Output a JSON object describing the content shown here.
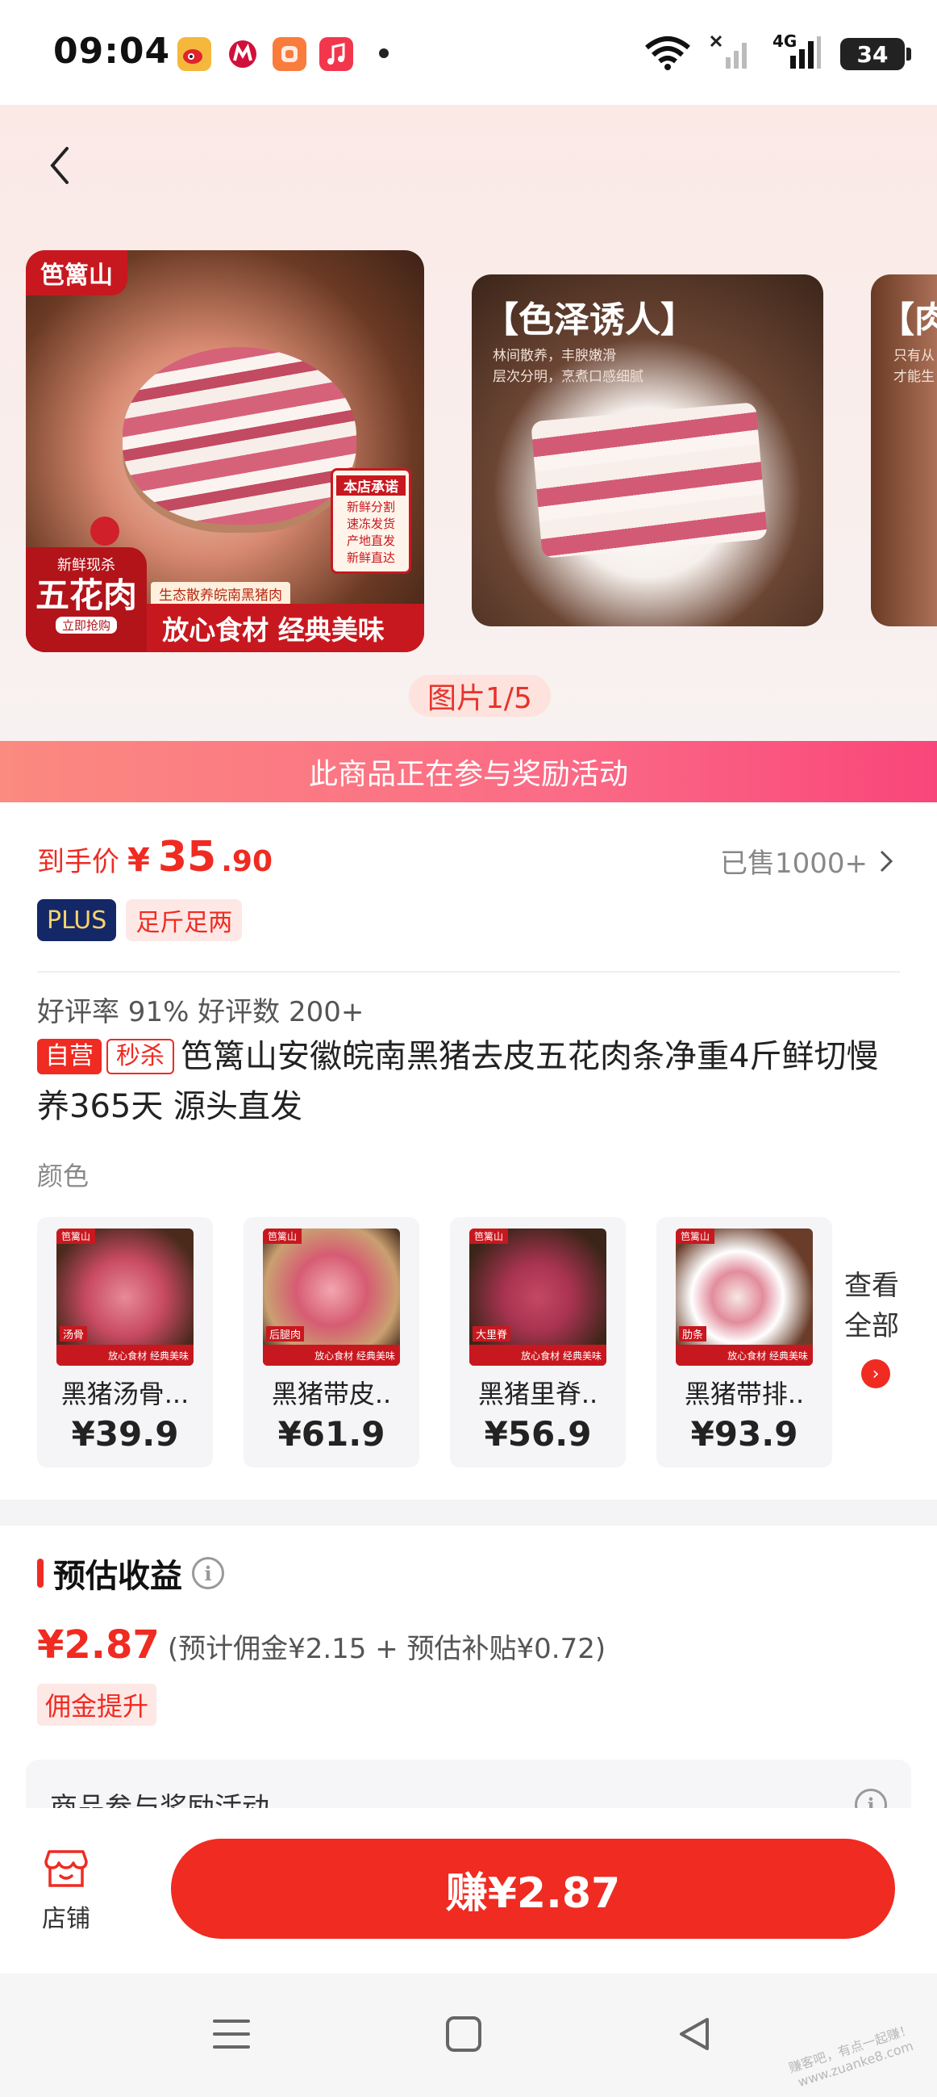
{
  "status_bar": {
    "time": "09:04",
    "network_label": "4G",
    "battery": "34",
    "app_icons": [
      "weibo-icon",
      "metro-icon",
      "taobao-icon",
      "music-icon"
    ]
  },
  "carousel": {
    "page_indicator": "图片1/5",
    "slide1": {
      "brand": "笆篱山",
      "badge_top": "新鲜现杀",
      "badge_main": "五花肉",
      "badge_btn": "立即抢购",
      "band_sub": "生态散养皖南黑猪肉",
      "band_main": "放心食材 经典美味",
      "promise_title": "本店承诺",
      "promise_lines": [
        "新鲜分割",
        "速冻发货",
        "产地直发",
        "新鲜直达"
      ]
    },
    "slide2": {
      "title": "【色泽诱人】",
      "sub1": "林间散养，丰腴嫩滑",
      "sub2": "层次分明，烹煮口感细腻"
    },
    "slide3": {
      "title": "【肉",
      "sub1": "只有从",
      "sub2": "才能生"
    }
  },
  "reward_banner": "此商品正在参与奖励活动",
  "price": {
    "label": "到手价",
    "symbol": "¥",
    "integer": "35",
    "decimal": ".90",
    "sold": "已售1000+",
    "tags": {
      "plus": "PLUS",
      "enough": "足斤足两"
    }
  },
  "rating": "好评率 91% 好评数 200+",
  "product": {
    "tag_self": "自营",
    "tag_flash": "秒杀",
    "title": "笆篱山安徽皖南黑猪去皮五花肉条净重4斤鲜切慢养365天 源头直发"
  },
  "variants": {
    "label": "颜色",
    "items": [
      {
        "name": "黑猪汤骨...",
        "price": "¥39.9",
        "img_tag": "汤骨"
      },
      {
        "name": "黑猪带皮..",
        "price": "¥61.9",
        "img_tag": "后腿肉"
      },
      {
        "name": "黑猪里脊..",
        "price": "¥56.9",
        "img_tag": "大里脊"
      },
      {
        "name": "黑猪带排..",
        "price": "¥93.9",
        "img_tag": "肋条"
      }
    ],
    "img_brand": "笆篱山",
    "img_band": "放心食材 经典美味",
    "see_all_1": "查看",
    "see_all_2": "全部"
  },
  "earnings": {
    "title": "预估收益",
    "amount": "¥2.87",
    "detail": "(预计佣金¥2.15 + 预估补贴¥0.72)",
    "tag": "佣金提升",
    "activity": "商品参与奖励活动"
  },
  "bottom_bar": {
    "shop_label": "店铺",
    "earn_button": "赚¥2.87"
  },
  "watermark": {
    "line1": "赚客吧，有点一起赚！",
    "line2": "www.zuanke8.com"
  },
  "colors": {
    "accent": "#ef2b22",
    "banner_start": "#fb8a80",
    "banner_end": "#f9467a",
    "plus_bg": "#142766"
  }
}
